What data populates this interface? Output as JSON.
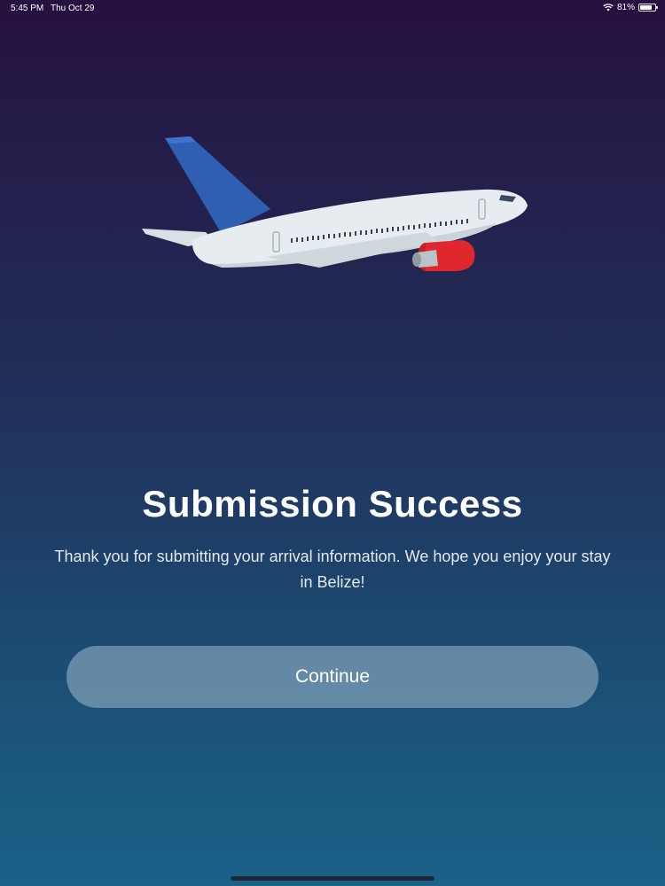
{
  "status_bar": {
    "time": "5:45 PM",
    "date": "Thu Oct 29",
    "battery_text": "81%",
    "battery_level": 0.81,
    "wifi_icon": "wifi-icon",
    "battery_icon": "battery-icon"
  },
  "illustration": {
    "icon": "airplane-illustration",
    "colors": {
      "tail": "#2f5fb3",
      "fuselage": "#e6ecef",
      "engine": "#e0272f"
    }
  },
  "content": {
    "title": "Submission Success",
    "message": "Thank you for submitting your arrival information. We hope you enjoy your stay in Belize!"
  },
  "actions": {
    "continue_label": "Continue"
  },
  "theme": {
    "gradient_top": "#26113f",
    "gradient_bottom": "#1a6288",
    "button_bg": "#7f9bb4"
  }
}
